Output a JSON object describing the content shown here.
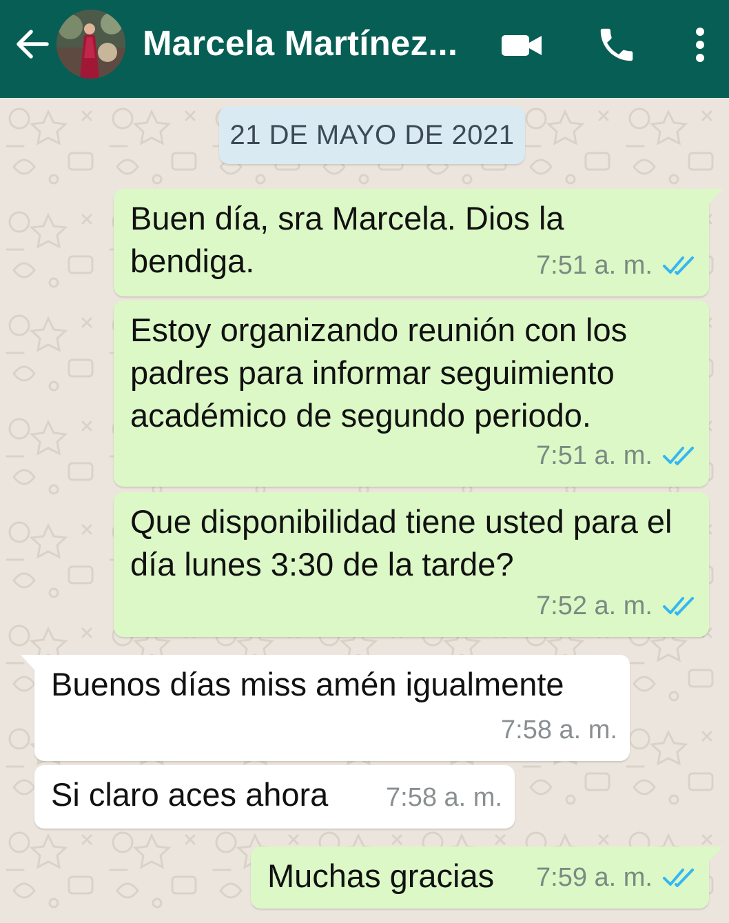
{
  "header": {
    "contact_name": "Marcela Martínez...",
    "colors": {
      "bar": "#075e54",
      "icon": "#ffffff"
    },
    "icons": [
      "arrow-back-icon",
      "video-call-icon",
      "phone-icon",
      "more-vert-icon"
    ]
  },
  "chat": {
    "date_chip": "21 DE MAYO DE 2021",
    "colors": {
      "outgoing": "#dcf8c6",
      "incoming": "#ffffff",
      "read_ticks": "#34b7f1"
    },
    "messages": [
      {
        "direction": "out",
        "text": "Buen día, sra Marcela. Dios la bendiga.",
        "time": "7:51 a. m.",
        "status": "read"
      },
      {
        "direction": "out",
        "text": "Estoy organizando reunión con los padres para informar seguimiento académico de segundo periodo.",
        "time": "7:51 a. m.",
        "status": "read"
      },
      {
        "direction": "out",
        "text": "Que disponibilidad tiene usted para el día lunes 3:30 de la tarde?",
        "time": "7:52 a. m.",
        "status": "read"
      },
      {
        "direction": "in",
        "text": "Buenos días miss amén igualmente",
        "time": "7:58 a. m."
      },
      {
        "direction": "in",
        "text": "Si claro aces ahora",
        "time": "7:58 a. m."
      },
      {
        "direction": "out",
        "text": "Muchas gracias",
        "time": "7:59 a. m.",
        "status": "read"
      }
    ]
  }
}
